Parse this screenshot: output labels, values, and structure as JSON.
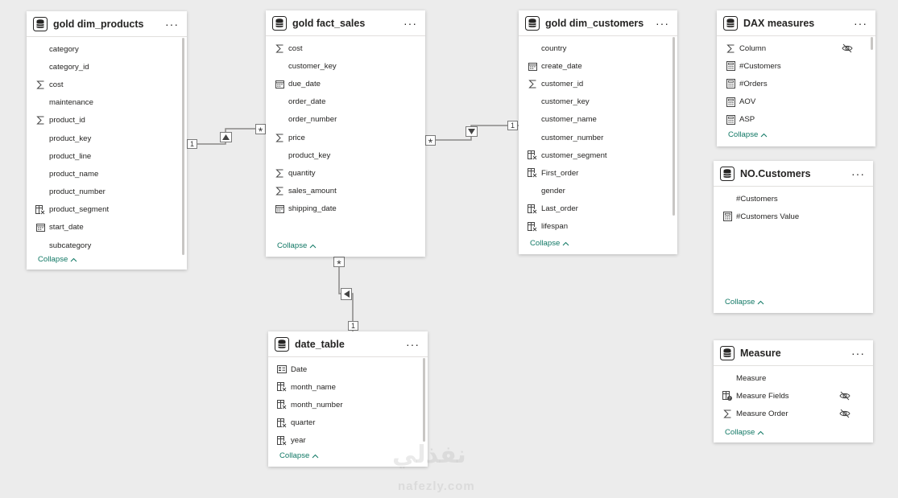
{
  "tables": {
    "products": {
      "title": "gold dim_products",
      "collapse_label": "Collapse",
      "fields": [
        {
          "name": "category",
          "icon": "none"
        },
        {
          "name": "category_id",
          "icon": "none"
        },
        {
          "name": "cost",
          "icon": "sigma-icon"
        },
        {
          "name": "maintenance",
          "icon": "none"
        },
        {
          "name": "product_id",
          "icon": "sigma-icon"
        },
        {
          "name": "product_key",
          "icon": "none"
        },
        {
          "name": "product_line",
          "icon": "none"
        },
        {
          "name": "product_name",
          "icon": "none"
        },
        {
          "name": "product_number",
          "icon": "none"
        },
        {
          "name": "product_segment",
          "icon": "calculated-column-icon"
        },
        {
          "name": "start_date",
          "icon": "calendar-icon"
        },
        {
          "name": "subcategory",
          "icon": "none"
        }
      ]
    },
    "fact_sales": {
      "title": "gold fact_sales",
      "collapse_label": "Collapse",
      "fields": [
        {
          "name": "cost",
          "icon": "sigma-icon"
        },
        {
          "name": "customer_key",
          "icon": "none"
        },
        {
          "name": "due_date",
          "icon": "calendar-icon"
        },
        {
          "name": "order_date",
          "icon": "none"
        },
        {
          "name": "order_number",
          "icon": "none"
        },
        {
          "name": "price",
          "icon": "sigma-icon"
        },
        {
          "name": "product_key",
          "icon": "none"
        },
        {
          "name": "quantity",
          "icon": "sigma-icon"
        },
        {
          "name": "sales_amount",
          "icon": "sigma-icon"
        },
        {
          "name": "shipping_date",
          "icon": "calendar-icon"
        }
      ]
    },
    "customers": {
      "title": "gold dim_customers",
      "collapse_label": "Collapse",
      "fields": [
        {
          "name": "country",
          "icon": "none"
        },
        {
          "name": "create_date",
          "icon": "calendar-icon"
        },
        {
          "name": "customer_id",
          "icon": "sigma-icon"
        },
        {
          "name": "customer_key",
          "icon": "none"
        },
        {
          "name": "customer_name",
          "icon": "none"
        },
        {
          "name": "customer_number",
          "icon": "none"
        },
        {
          "name": "customer_segment",
          "icon": "calculated-column-icon"
        },
        {
          "name": "First_order",
          "icon": "calculated-column-icon"
        },
        {
          "name": "gender",
          "icon": "none"
        },
        {
          "name": "Last_order",
          "icon": "calculated-column-icon"
        },
        {
          "name": "lifespan",
          "icon": "calculated-column-icon"
        }
      ]
    },
    "dax": {
      "title": "DAX measures",
      "collapse_label": "Collapse",
      "fields": [
        {
          "name": "Column",
          "icon": "sigma-icon",
          "hidden": true
        },
        {
          "name": "#Customers",
          "icon": "measure-icon"
        },
        {
          "name": "#Orders",
          "icon": "measure-icon"
        },
        {
          "name": "AOV",
          "icon": "measure-icon"
        },
        {
          "name": "ASP",
          "icon": "measure-icon"
        }
      ]
    },
    "nocustomers": {
      "title": "NO.Customers",
      "collapse_label": "Collapse",
      "fields": [
        {
          "name": "#Customers",
          "icon": "none"
        },
        {
          "name": "#Customers Value",
          "icon": "measure-icon"
        }
      ]
    },
    "measure": {
      "title": "Measure",
      "collapse_label": "Collapse",
      "fields": [
        {
          "name": "Measure",
          "icon": "none"
        },
        {
          "name": "Measure Fields",
          "icon": "field-parameter-icon",
          "hidden": true
        },
        {
          "name": "Measure Order",
          "icon": "sigma-icon",
          "hidden": true
        }
      ]
    },
    "date": {
      "title": "date_table",
      "collapse_label": "Collapse",
      "fields": [
        {
          "name": "Date",
          "icon": "date-hierarchy-icon"
        },
        {
          "name": "month_name",
          "icon": "calculated-column-icon"
        },
        {
          "name": "month_number",
          "icon": "calculated-column-icon"
        },
        {
          "name": "quarter",
          "icon": "calculated-column-icon"
        },
        {
          "name": "year",
          "icon": "calculated-column-icon"
        }
      ]
    }
  },
  "relationships": {
    "one_label": "1",
    "many_label": "*"
  },
  "colors": {
    "accent": "#117865",
    "line": "#8a8886"
  },
  "watermark": {
    "arabic": "نفذلي",
    "latin": "nafezly.com"
  }
}
